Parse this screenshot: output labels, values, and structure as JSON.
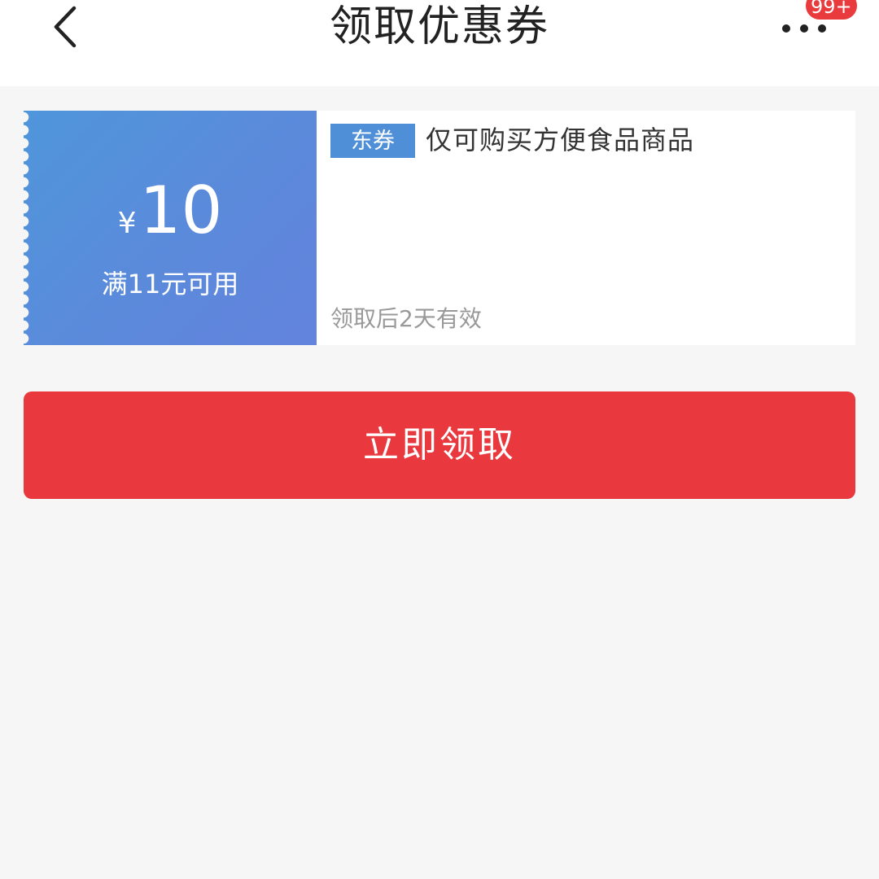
{
  "header": {
    "title": "领取优惠券",
    "back_icon": "chevron-left-icon",
    "more_icon": "more-dots-icon",
    "badge": "99+"
  },
  "coupon": {
    "currency": "¥",
    "amount": "10",
    "condition": "满11元可用",
    "tag": "东券",
    "description": "仅可购买方便食品商品",
    "validity": "领取后2天有效",
    "colors": {
      "gradient_start": "#4f96db",
      "gradient_end": "#6383dc",
      "tag_bg": "#4f8fd7"
    }
  },
  "action": {
    "claim_label": "立即领取",
    "color": "#e9393f"
  }
}
